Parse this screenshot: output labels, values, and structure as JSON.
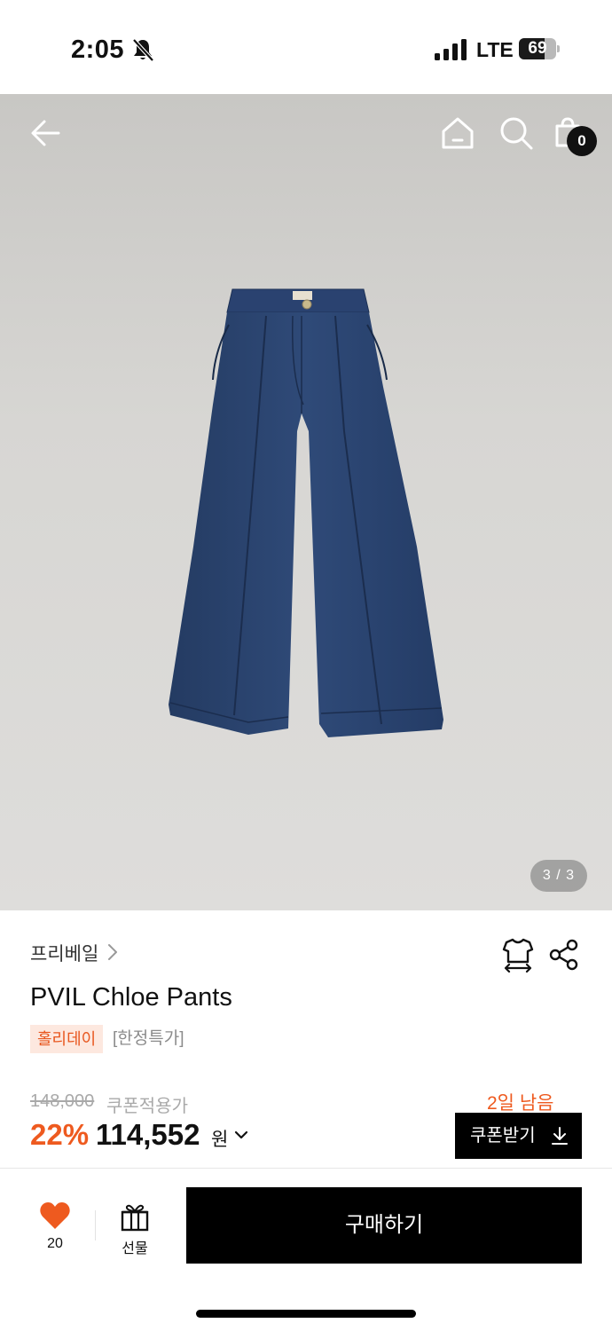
{
  "status_bar": {
    "time": "2:05",
    "network": "LTE",
    "battery_level": "69",
    "battery_fraction": 0.69,
    "icons": [
      "bell-slash-icon",
      "signal-icon",
      "battery-icon"
    ]
  },
  "header": {
    "cart_count": "0",
    "icons": [
      "back-arrow-icon",
      "home-icon",
      "search-icon",
      "shopping-bag-icon"
    ]
  },
  "gallery": {
    "pager": "3 / 3",
    "image_subject": "denim-wide-pants"
  },
  "product": {
    "brand": "프리베일",
    "name": "PVIL Chloe Pants",
    "tags": {
      "holiday": "홀리데이",
      "limited": "[한정특가]"
    },
    "original_price": "148,000",
    "coupon_price_label": "쿠폰적용가",
    "discount": "22%",
    "price": "114,552",
    "currency": "원",
    "days_left": "2일 남음",
    "coupon_button": "쿠폰받기"
  },
  "bottom_bar": {
    "like_count": "20",
    "gift_label": "선물",
    "buy_label": "구매하기"
  },
  "colors": {
    "accent": "#ee5a1f",
    "tag_bg": "#fde8df",
    "primary_button": "#000000"
  }
}
